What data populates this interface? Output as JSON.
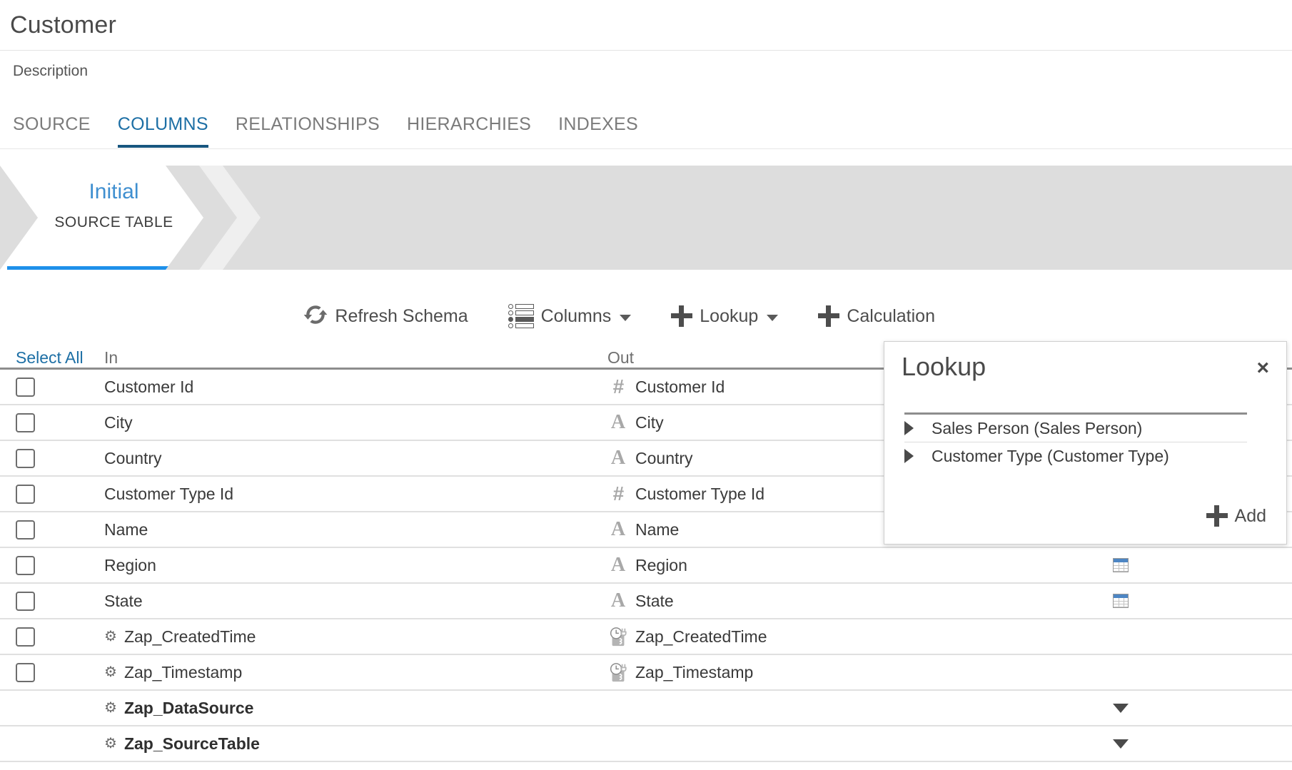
{
  "header": {
    "title": "Customer",
    "description_label": "Description"
  },
  "tabs": [
    {
      "label": "SOURCE",
      "active": false
    },
    {
      "label": "COLUMNS",
      "active": true
    },
    {
      "label": "RELATIONSHIPS",
      "active": false
    },
    {
      "label": "HIERARCHIES",
      "active": false
    },
    {
      "label": "INDEXES",
      "active": false
    }
  ],
  "stage": {
    "initial_name": "Initial",
    "initial_kind": "SOURCE TABLE",
    "add_label": "+",
    "accent_color": "#1e90ea",
    "band_color": "#dddddd"
  },
  "toolbar": {
    "refresh_schema": "Refresh Schema",
    "columns": "Columns",
    "lookup": "Lookup",
    "calculation": "Calculation"
  },
  "grid": {
    "select_all": "Select All",
    "head_in": "In",
    "head_out": "Out",
    "rows": [
      {
        "checkbox": true,
        "gear": false,
        "in": "Customer Id",
        "type": "number",
        "out": "Customer Id",
        "extra": "none",
        "system": false
      },
      {
        "checkbox": true,
        "gear": false,
        "in": "City",
        "type": "text",
        "out": "City",
        "extra": "none",
        "system": false
      },
      {
        "checkbox": true,
        "gear": false,
        "in": "Country",
        "type": "text",
        "out": "Country",
        "extra": "none",
        "system": false
      },
      {
        "checkbox": true,
        "gear": false,
        "in": "Customer Type Id",
        "type": "number",
        "out": "Customer Type Id",
        "extra": "none",
        "system": false
      },
      {
        "checkbox": true,
        "gear": false,
        "in": "Name",
        "type": "text",
        "out": "Name",
        "extra": "none",
        "system": false
      },
      {
        "checkbox": true,
        "gear": false,
        "in": "Region",
        "type": "text",
        "out": "Region",
        "extra": "table",
        "system": false
      },
      {
        "checkbox": true,
        "gear": false,
        "in": "State",
        "type": "text",
        "out": "State",
        "extra": "table",
        "system": false
      },
      {
        "checkbox": true,
        "gear": true,
        "in": "Zap_CreatedTime",
        "type": "datetime",
        "out": "Zap_CreatedTime",
        "extra": "none",
        "system": false
      },
      {
        "checkbox": true,
        "gear": true,
        "in": "Zap_Timestamp",
        "type": "datetime",
        "out": "Zap_Timestamp",
        "extra": "none",
        "system": false
      },
      {
        "checkbox": false,
        "gear": true,
        "in": "Zap_DataSource",
        "type": "none",
        "out": "",
        "extra": "caret",
        "system": true
      },
      {
        "checkbox": false,
        "gear": true,
        "in": "Zap_SourceTable",
        "type": "none",
        "out": "",
        "extra": "caret",
        "system": true
      }
    ]
  },
  "lookup_popover": {
    "title": "Lookup",
    "close_label": "×",
    "add_label": "Add",
    "items": [
      {
        "label": "Sales Person (Sales Person)"
      },
      {
        "label": "Customer Type (Customer Type)"
      }
    ]
  },
  "type_glyphs": {
    "number": "#",
    "text": "A"
  }
}
